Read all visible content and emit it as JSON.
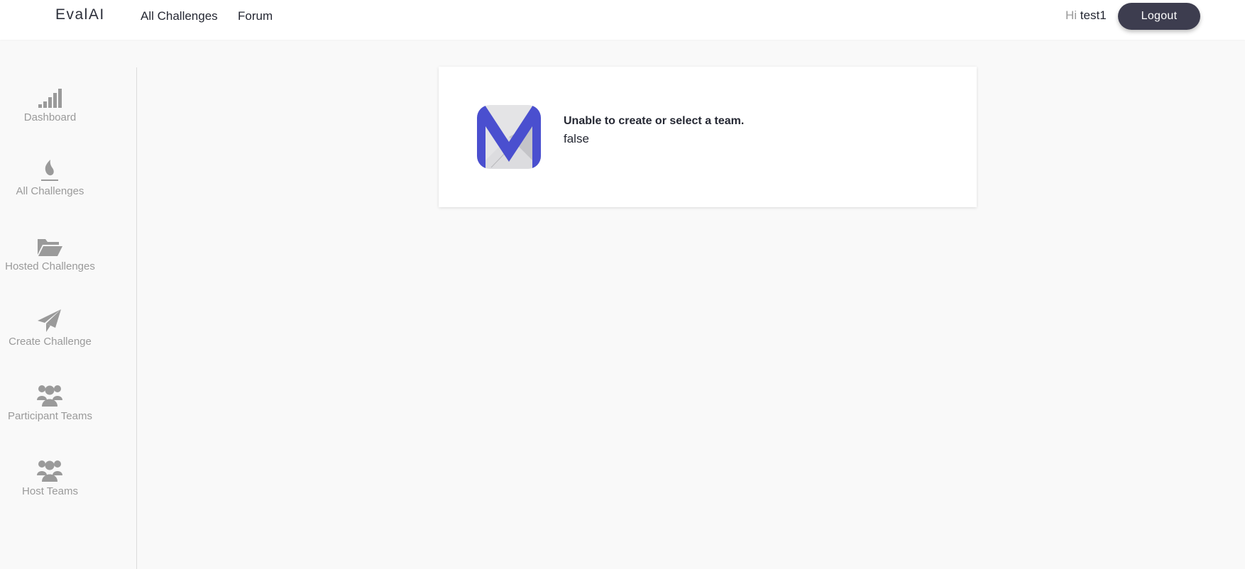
{
  "brand": {
    "logo_text": "EvalAI"
  },
  "nav": {
    "all_challenges": "All Challenges",
    "forum": "Forum"
  },
  "user": {
    "greeting": "Hi",
    "username": "test1",
    "logout_label": "Logout"
  },
  "sidebar": {
    "items": [
      {
        "label": "Dashboard",
        "icon": "bar-signal-icon"
      },
      {
        "label": "All Challenges",
        "icon": "flame-icon"
      },
      {
        "label": "Hosted Challenges",
        "icon": "folder-open-icon"
      },
      {
        "label": "Create Challenge",
        "icon": "paper-plane-icon"
      },
      {
        "label": "Participant Teams",
        "icon": "users-icon"
      },
      {
        "label": "Host Teams",
        "icon": "users-icon"
      }
    ]
  },
  "message": {
    "title": "Unable to create or select a team.",
    "detail": "false"
  },
  "colors": {
    "logout_bg": "#3d3d4f",
    "icon_gray": "#9a9a9a",
    "page_bg": "#f9f9f9",
    "logo_blue": "#4a4fcf"
  }
}
